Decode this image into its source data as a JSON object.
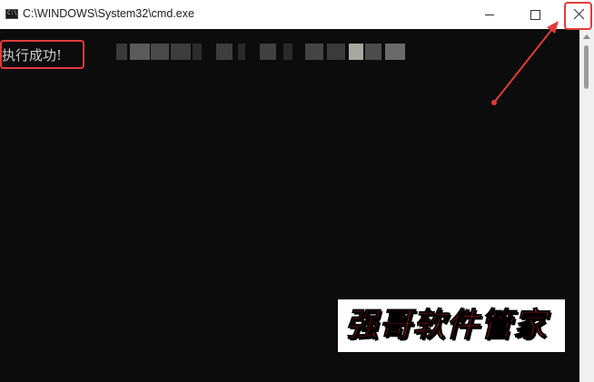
{
  "window": {
    "title": "C:\\WINDOWS\\System32\\cmd.exe",
    "icon": "cmd-console-icon",
    "icon_glyph": "C:\\"
  },
  "controls": {
    "minimize_icon": "minimize-icon",
    "maximize_icon": "maximize-icon",
    "close_icon": "close-icon"
  },
  "console": {
    "output_line": "执行成功!",
    "background": "#0c0c0c",
    "text_color": "#cccccc"
  },
  "annotations": {
    "highlight_color": "#e23b3b"
  },
  "watermark": {
    "text": "强哥软件管家",
    "color": "#e11d1d"
  }
}
